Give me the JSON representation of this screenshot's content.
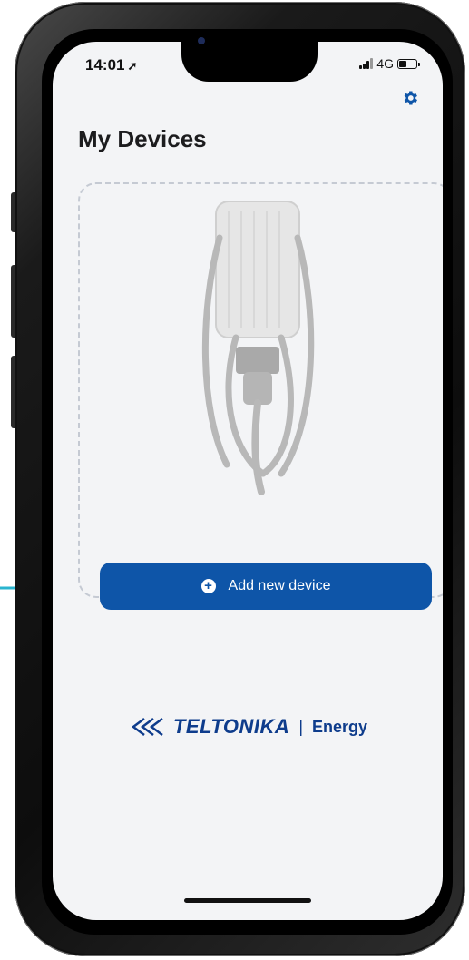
{
  "status_bar": {
    "time": "14:01",
    "network": "4G",
    "battery_level": 0.45
  },
  "header": {
    "title": "My Devices",
    "settings_icon": "gear-icon"
  },
  "device_card": {
    "image": "ev-charger-illustration",
    "add_button_label": "Add new device",
    "add_button_icon": "plus-circle-icon"
  },
  "brand": {
    "name": "TELTONIKA",
    "separator": "|",
    "product": "Energy",
    "color": "#0e3c8c"
  },
  "colors": {
    "accent": "#0e55a8",
    "pointer": "#2ab4cf",
    "background": "#f3f4f6"
  }
}
